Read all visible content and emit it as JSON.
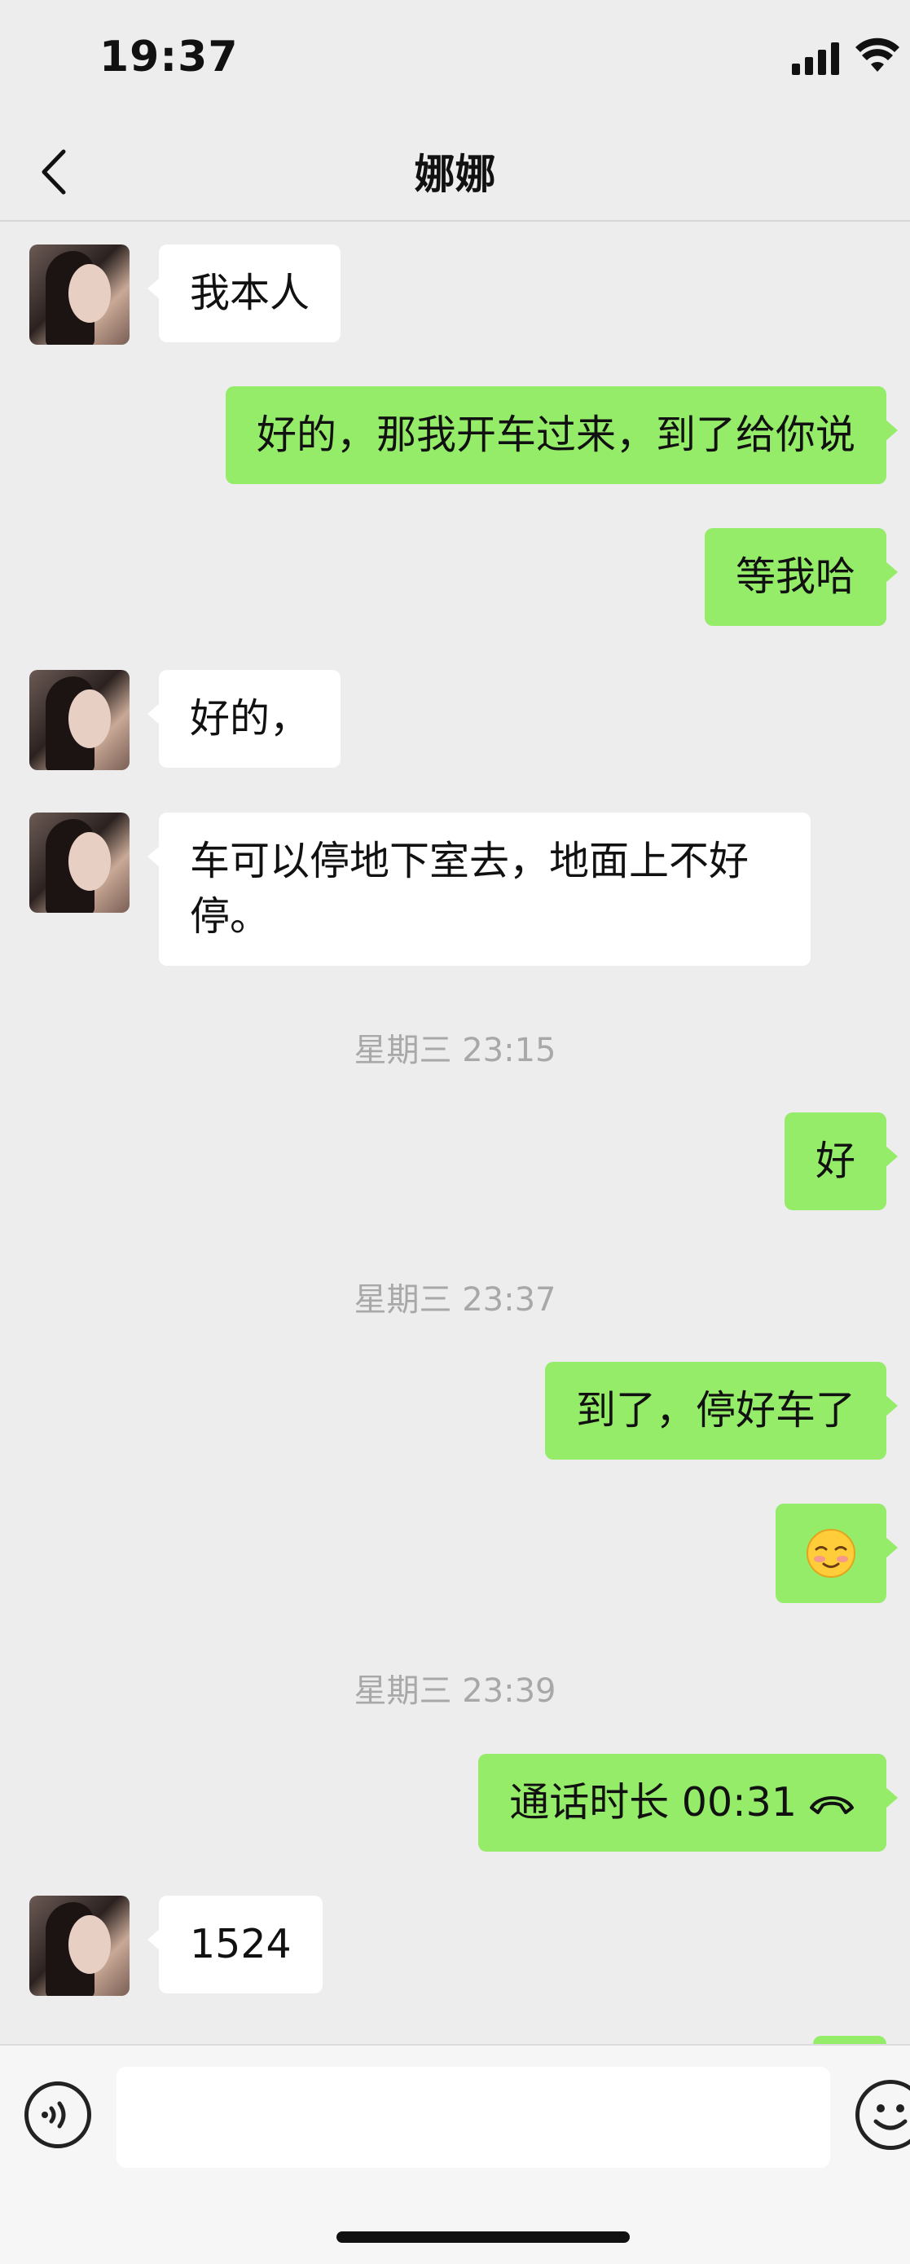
{
  "status_bar": {
    "time": "19:37"
  },
  "header": {
    "title": "娜娜"
  },
  "messages": [
    {
      "side": "left",
      "text": "我本人"
    },
    {
      "side": "right",
      "text": "好的，那我开车过来，到了给你说"
    },
    {
      "side": "right",
      "text": "等我哈"
    },
    {
      "side": "left",
      "text": "好的，"
    },
    {
      "side": "left",
      "text": "车可以停地下室去，地面上不好停。"
    },
    {
      "side": "time",
      "text": "星期三 23:15"
    },
    {
      "side": "right",
      "text": "好"
    },
    {
      "side": "time",
      "text": "星期三 23:37"
    },
    {
      "side": "right",
      "text": "到了，停好车了"
    },
    {
      "side": "right",
      "text": "☺"
    },
    {
      "side": "time",
      "text": "星期三 23:39"
    },
    {
      "side": "right",
      "text": "通话时长 00:31"
    },
    {
      "side": "left",
      "text": "1524"
    }
  ],
  "icons": {
    "back": "chevron-left-icon",
    "call": "phone-hangup-icon",
    "voice": "voice-input-icon",
    "emoji": "emoji-icon"
  },
  "colors": {
    "background": "#ededed",
    "sent_bubble": "#95ec69",
    "received_bubble": "#ffffff",
    "timestamp": "#a8a8a8"
  }
}
